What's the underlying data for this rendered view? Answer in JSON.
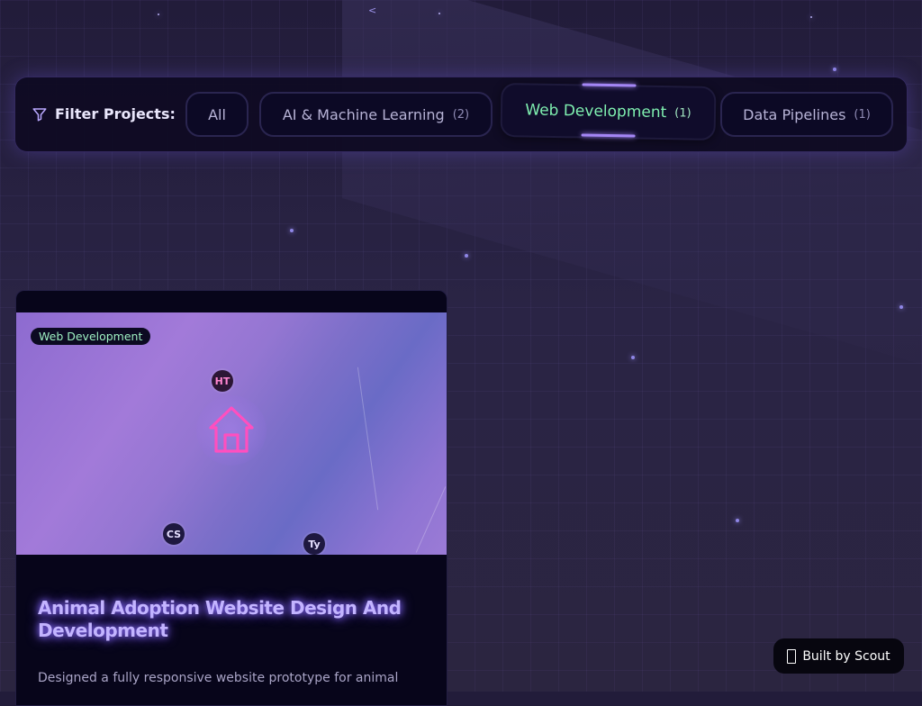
{
  "filter": {
    "label": "Filter Projects:",
    "icon": "filter-icon",
    "options": [
      {
        "label": "All",
        "count": ""
      },
      {
        "label": "AI & Machine Learning",
        "count": "(2)"
      },
      {
        "label": "Web Development",
        "count": "(1)",
        "selected": true
      },
      {
        "label": "Data Pipelines",
        "count": "(1)"
      }
    ]
  },
  "background": {
    "glyph_text": "<"
  },
  "project": {
    "category": "Web Development",
    "tech": [
      "HT",
      "CS",
      "Ty"
    ],
    "icon": "house-icon",
    "title": "Animal Adoption Website Design And Development",
    "description": "Designed a fully responsive website prototype for animal"
  },
  "built_by": {
    "label": "Built by Scout"
  },
  "colors": {
    "accent_green": "#7ff0b0",
    "accent_purple": "#a486f5",
    "house_icon": "#ff4fbf"
  }
}
